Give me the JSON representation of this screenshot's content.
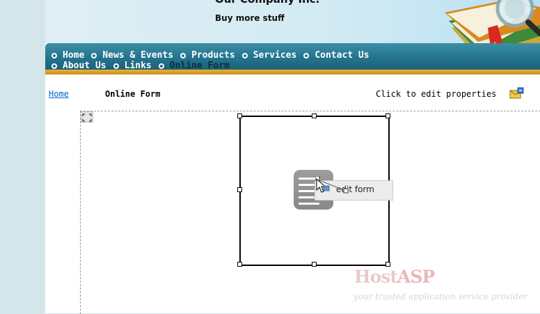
{
  "header": {
    "company_name": "Our Company Inc.",
    "tagline": "Buy more stuff"
  },
  "nav": {
    "row1": [
      "Home",
      "News & Events",
      "Products",
      "Services",
      "Contact Us"
    ],
    "row2": [
      "About Us",
      "Links",
      "Online Form"
    ]
  },
  "breadcrumb": {
    "home_link": "Home",
    "page_title": "Online Form"
  },
  "properties": {
    "label": "Click to edit properties",
    "icon": "envelope-edit-icon"
  },
  "editor": {
    "edit_form_label": "edit form",
    "form_icon": "form-icon",
    "expand_icon": "expand-icon"
  },
  "watermark": {
    "brand_host": "Host",
    "brand_asp": "ASP",
    "tagline": "your trusted application service provider"
  },
  "colors": {
    "nav_background": "#24748e",
    "nav_accent": "#e7b53c",
    "sidebar_background": "#d5e6ea",
    "link": "#0066cc"
  }
}
